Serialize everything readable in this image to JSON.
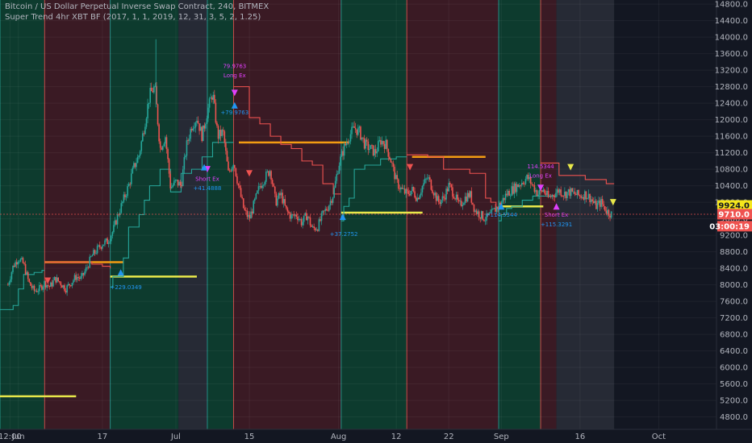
{
  "header": {
    "line1": "Bitcoin / US Dollar Perpetual Inverse Swap Contract, 240, BITMEX",
    "line2": "Super Trend 4hr XBT BF (2017, 1, 1, 2019, 12, 31, 3, 5, 2, 1.25)"
  },
  "colors": {
    "background": "#131722",
    "up_candle": "#26a69a",
    "down_candle": "#ef5350",
    "trend_up": "#26a69a",
    "trend_down": "#ef5350",
    "zone_long": "#0d3b2e",
    "zone_short": "#3a1a24",
    "zone_neutral": "#262a35",
    "level_yellow": "#e8e84a",
    "level_orange": "#f39c12",
    "signal_blue": "#2196f3",
    "signal_magenta": "#e040fb",
    "price_tag_yellow": "#f5e71c",
    "price_tag_red": "#ef5350"
  },
  "chart_data": {
    "type": "candlestick",
    "title": "Bitcoin / US Dollar Perpetual Inverse Swap Contract, 240, BITMEX",
    "ylim": [
      4500,
      14900
    ],
    "y_ticks": [
      4800,
      5200,
      5600,
      6000,
      6400,
      6800,
      7200,
      7600,
      8000,
      8400,
      8800,
      9200,
      9600,
      10000,
      10400,
      10800,
      11200,
      11600,
      12000,
      12400,
      12800,
      13200,
      13600,
      14000,
      14400,
      14800
    ],
    "x_labels": [
      {
        "label": "12:00",
        "x": 0.4
      },
      {
        "label": "Jun",
        "x": 2
      },
      {
        "label": "17",
        "x": 18
      },
      {
        "label": "Jul",
        "x": 32
      },
      {
        "label": "15",
        "x": 46
      },
      {
        "label": "Aug",
        "x": 63
      },
      {
        "label": "12",
        "x": 74
      },
      {
        "label": "22",
        "x": 84
      },
      {
        "label": "Sep",
        "x": 94
      },
      {
        "label": "16",
        "x": 109
      },
      {
        "label": "Oct",
        "x": 124
      }
    ],
    "x_range": [
      -1.5,
      135
    ],
    "price_path": [
      [
        0,
        8000
      ],
      [
        1,
        8450
      ],
      [
        2,
        8650
      ],
      [
        3,
        8500
      ],
      [
        4,
        8050
      ],
      [
        5,
        7850
      ],
      [
        6,
        7900
      ],
      [
        7,
        8050
      ],
      [
        8,
        7950
      ],
      [
        9,
        8150
      ],
      [
        10,
        8050
      ],
      [
        11,
        7900
      ],
      [
        12,
        8050
      ],
      [
        13,
        8200
      ],
      [
        14,
        8150
      ],
      [
        15,
        8400
      ],
      [
        16,
        8700
      ],
      [
        17,
        8850
      ],
      [
        18,
        9000
      ],
      [
        19,
        9050
      ],
      [
        20,
        9300
      ],
      [
        21,
        9700
      ],
      [
        22,
        10050
      ],
      [
        23,
        10400
      ],
      [
        24,
        10850
      ],
      [
        25,
        11150
      ],
      [
        26,
        11850
      ],
      [
        27,
        12600
      ],
      [
        28,
        12800
      ],
      [
        29,
        11300
      ],
      [
        30,
        11600
      ],
      [
        31,
        10350
      ],
      [
        32,
        10500
      ],
      [
        33,
        10400
      ],
      [
        34,
        11350
      ],
      [
        35,
        11850
      ],
      [
        36,
        12050
      ],
      [
        37,
        11600
      ],
      [
        38,
        12200
      ],
      [
        39,
        12650
      ],
      [
        40,
        11600
      ],
      [
        41,
        11700
      ],
      [
        42,
        10700
      ],
      [
        43,
        11000
      ],
      [
        44,
        10350
      ],
      [
        45,
        9800
      ],
      [
        46,
        9600
      ],
      [
        47,
        10000
      ],
      [
        48,
        10400
      ],
      [
        49,
        10600
      ],
      [
        50,
        10800
      ],
      [
        51,
        10000
      ],
      [
        52,
        10200
      ],
      [
        53,
        9800
      ],
      [
        54,
        9650
      ],
      [
        55,
        9700
      ],
      [
        56,
        9500
      ],
      [
        57,
        9700
      ],
      [
        58,
        9350
      ],
      [
        59,
        9400
      ],
      [
        60,
        9700
      ],
      [
        61,
        9900
      ],
      [
        62,
        10200
      ],
      [
        63,
        10900
      ],
      [
        64,
        11300
      ],
      [
        65,
        11600
      ],
      [
        66,
        11800
      ],
      [
        67,
        11700
      ],
      [
        68,
        11400
      ],
      [
        69,
        11300
      ],
      [
        70,
        11200
      ],
      [
        71,
        11500
      ],
      [
        72,
        11400
      ],
      [
        73,
        11000
      ],
      [
        74,
        10500
      ],
      [
        75,
        10300
      ],
      [
        76,
        10200
      ],
      [
        77,
        10300
      ],
      [
        78,
        10100
      ],
      [
        79,
        10400
      ],
      [
        80,
        10600
      ],
      [
        81,
        10300
      ],
      [
        82,
        10000
      ],
      [
        83,
        10100
      ],
      [
        84,
        10400
      ],
      [
        85,
        10200
      ],
      [
        86,
        9900
      ],
      [
        87,
        10100
      ],
      [
        88,
        10200
      ],
      [
        89,
        9800
      ],
      [
        90,
        9700
      ],
      [
        91,
        9600
      ],
      [
        92,
        9700
      ],
      [
        93,
        9850
      ],
      [
        94,
        10000
      ],
      [
        95,
        10200
      ],
      [
        96,
        10300
      ],
      [
        97,
        10400
      ],
      [
        98,
        10500
      ],
      [
        99,
        10600
      ],
      [
        100,
        10400
      ],
      [
        101,
        10200
      ],
      [
        102,
        10300
      ],
      [
        103,
        10100
      ],
      [
        104,
        10200
      ],
      [
        105,
        10300
      ],
      [
        106,
        10200
      ],
      [
        107,
        10250
      ],
      [
        108,
        10200
      ],
      [
        109,
        10150
      ],
      [
        110,
        10200
      ],
      [
        111,
        10100
      ],
      [
        112,
        9900
      ],
      [
        113,
        10000
      ],
      [
        114,
        9800
      ],
      [
        115,
        9710
      ]
    ],
    "zones": [
      {
        "type": "long",
        "from": -1.5,
        "to": 7
      },
      {
        "type": "short",
        "from": 7,
        "to": 19.5
      },
      {
        "type": "long",
        "from": 19.5,
        "to": 32.5
      },
      {
        "type": "neutral",
        "from": 32.5,
        "to": 38
      },
      {
        "type": "long",
        "from": 38,
        "to": 43
      },
      {
        "type": "short",
        "from": 43,
        "to": 63.5
      },
      {
        "type": "long",
        "from": 63.5,
        "to": 76
      },
      {
        "type": "short",
        "from": 76,
        "to": 93.5
      },
      {
        "type": "long",
        "from": 93.5,
        "to": 101.5
      },
      {
        "type": "short",
        "from": 101.5,
        "to": 104.5
      },
      {
        "type": "neutral",
        "from": 104.5,
        "to": 115.5
      }
    ],
    "trend_up_points": [
      [
        -1.5,
        7400
      ],
      [
        1,
        7500
      ],
      [
        2,
        7900
      ],
      [
        3,
        8250
      ],
      [
        5,
        8300
      ],
      [
        6.5,
        8350
      ],
      [
        7,
        8350
      ],
      [
        19.5,
        7950
      ],
      [
        20,
        8200
      ],
      [
        22,
        8650
      ],
      [
        23,
        9400
      ],
      [
        25,
        9700
      ],
      [
        26,
        10050
      ],
      [
        27,
        10400
      ],
      [
        29,
        10800
      ],
      [
        30,
        10800
      ],
      [
        31,
        10250
      ],
      [
        32,
        10250
      ],
      [
        32.5,
        10250
      ],
      [
        33,
        10700
      ],
      [
        35,
        10800
      ],
      [
        37,
        11100
      ],
      [
        39,
        11450
      ],
      [
        40,
        11450
      ],
      [
        42,
        11450
      ],
      [
        43,
        11450
      ],
      [
        63.5,
        9550
      ],
      [
        64,
        9900
      ],
      [
        65,
        10100
      ],
      [
        66,
        10800
      ],
      [
        68,
        10900
      ],
      [
        71,
        11050
      ],
      [
        74,
        11100
      ],
      [
        76,
        11100
      ],
      [
        93.5,
        9550
      ],
      [
        94,
        9700
      ],
      [
        95,
        9850
      ],
      [
        96,
        9900
      ],
      [
        98,
        10050
      ],
      [
        100,
        10150
      ],
      [
        101.5,
        10150
      ],
      [
        104.5,
        10150
      ]
    ],
    "trend_down_points": [
      [
        7,
        8550
      ],
      [
        12,
        8550
      ],
      [
        16,
        8500
      ],
      [
        18,
        8450
      ],
      [
        19.5,
        8400
      ],
      [
        43,
        12800
      ],
      [
        45,
        12800
      ],
      [
        46,
        12050
      ],
      [
        48,
        11900
      ],
      [
        50,
        11600
      ],
      [
        52,
        11400
      ],
      [
        54,
        11300
      ],
      [
        56,
        11000
      ],
      [
        58,
        10900
      ],
      [
        60,
        10450
      ],
      [
        62,
        10200
      ],
      [
        63.5,
        10200
      ],
      [
        76,
        11150
      ],
      [
        80,
        11100
      ],
      [
        83,
        10800
      ],
      [
        85,
        10800
      ],
      [
        88,
        10700
      ],
      [
        90,
        10700
      ],
      [
        91,
        10100
      ],
      [
        92,
        10000
      ],
      [
        93,
        9850
      ],
      [
        93.5,
        9850
      ],
      [
        101.5,
        10950
      ],
      [
        104.5,
        10950
      ],
      [
        105,
        10650
      ],
      [
        107,
        10650
      ],
      [
        110,
        10550
      ],
      [
        112,
        10550
      ],
      [
        114,
        10450
      ],
      [
        115.5,
        10450
      ]
    ],
    "levels": [
      {
        "color": "level_yellow",
        "y": 5300,
        "from": -1.5,
        "to": 13
      },
      {
        "color": "level_orange",
        "y": 8550,
        "from": 7,
        "to": 22
      },
      {
        "color": "level_yellow",
        "y": 8200,
        "from": 19.5,
        "to": 36
      },
      {
        "color": "level_orange",
        "y": 11450,
        "from": 44,
        "to": 65
      },
      {
        "color": "level_yellow",
        "y": 9750,
        "from": 63.5,
        "to": 79
      },
      {
        "color": "level_orange",
        "y": 11100,
        "from": 77,
        "to": 91
      },
      {
        "color": "level_yellow",
        "y": 9900,
        "from": 94,
        "to": 102
      }
    ],
    "annotations": [
      {
        "text": "79.9763",
        "x": 43.2,
        "y": 13250,
        "color": "signal_magenta"
      },
      {
        "text": "Long Ex",
        "x": 43.2,
        "y": 13030,
        "color": "signal_magenta"
      },
      {
        "text": "+79.9763",
        "x": 43.2,
        "y": 12130,
        "color": "signal_blue"
      },
      {
        "text": "Short Ex",
        "x": 38,
        "y": 10520,
        "color": "signal_magenta"
      },
      {
        "text": "+41.4888",
        "x": 38,
        "y": 10300,
        "color": "signal_blue"
      },
      {
        "text": "+229.0349",
        "x": 22.5,
        "y": 7900,
        "color": "signal_blue"
      },
      {
        "text": "+37.2752",
        "x": 64,
        "y": 9180,
        "color": "signal_blue"
      },
      {
        "text": "114.5344",
        "x": 101.5,
        "y": 10820,
        "color": "signal_magenta"
      },
      {
        "text": "Long Ex",
        "x": 101.5,
        "y": 10600,
        "color": "signal_magenta"
      },
      {
        "text": "Short Ex",
        "x": 104.5,
        "y": 9650,
        "color": "signal_magenta"
      },
      {
        "text": "+115.3291",
        "x": 104.5,
        "y": 9420,
        "color": "signal_blue"
      },
      {
        "text": "+114.5344",
        "x": 94,
        "y": 9650,
        "color": "signal_blue"
      }
    ],
    "arrows": [
      {
        "x": 43.2,
        "y": 12650,
        "dir": "down",
        "color": "signal_magenta"
      },
      {
        "x": 43.2,
        "y": 12350,
        "dir": "up",
        "color": "signal_blue"
      },
      {
        "x": 38,
        "y": 10800,
        "dir": "down",
        "color": "signal_magenta"
      },
      {
        "x": 37.4,
        "y": 10850,
        "dir": "up",
        "color": "signal_blue"
      },
      {
        "x": 21.5,
        "y": 8300,
        "dir": "up",
        "color": "signal_blue"
      },
      {
        "x": 7.6,
        "y": 8100,
        "dir": "down",
        "color": "down_candle"
      },
      {
        "x": 46,
        "y": 10700,
        "dir": "down",
        "color": "down_candle"
      },
      {
        "x": 63.8,
        "y": 9650,
        "dir": "up",
        "color": "signal_blue"
      },
      {
        "x": 76.6,
        "y": 10850,
        "dir": "down",
        "color": "down_candle"
      },
      {
        "x": 94,
        "y": 9900,
        "dir": "up",
        "color": "signal_blue"
      },
      {
        "x": 101.5,
        "y": 10350,
        "dir": "down",
        "color": "signal_magenta"
      },
      {
        "x": 104.5,
        "y": 9900,
        "dir": "up",
        "color": "signal_magenta"
      },
      {
        "x": 107.2,
        "y": 10850,
        "dir": "down",
        "color": "level_yellow"
      },
      {
        "x": 115.3,
        "y": 10000,
        "dir": "down",
        "color": "level_yellow"
      }
    ],
    "price_tags": [
      {
        "text": "9924.0",
        "y": 9924,
        "color": "price_tag_yellow",
        "text_color": "#131722"
      },
      {
        "text": "9710.0",
        "y": 9710,
        "color": "price_tag_red",
        "text_color": "#ffffff"
      },
      {
        "text": "03:00:19",
        "y": 9420,
        "color": "price_tag_red",
        "text_color": "#ffffff"
      }
    ],
    "crosshair_y": 9710
  }
}
